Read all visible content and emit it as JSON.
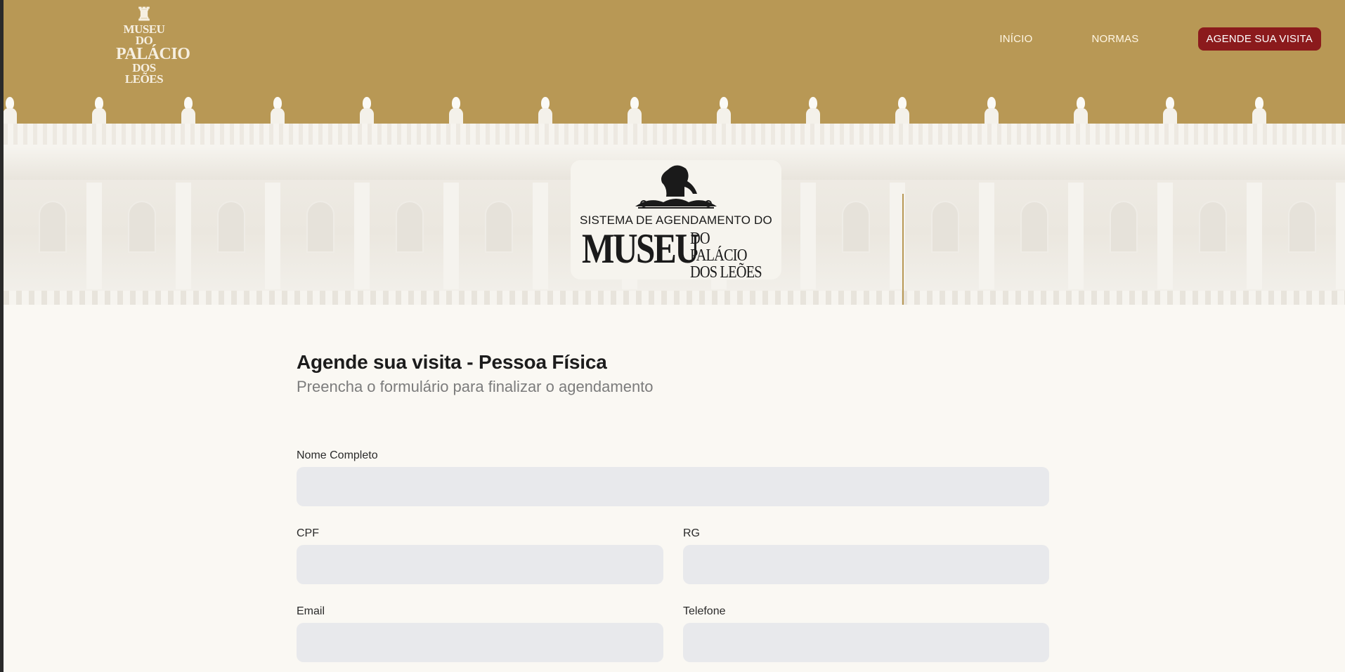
{
  "header": {
    "logo": {
      "line1": "MUSEU DO",
      "line2": "PALÁCIO",
      "line3": "DOS LEÕES"
    },
    "nav": [
      {
        "label": "INÍCIO"
      },
      {
        "label": "NORMAS"
      }
    ],
    "cta_label": "AGENDE SUA VISITA"
  },
  "hero": {
    "subtitle": "SISTEMA DE AGENDAMENTO DO",
    "museu": "MUSEU",
    "do_palacio": "DO PALÁCIO",
    "dos_leoes": "DOS LEÕES"
  },
  "form": {
    "title": "Agende sua visita - Pessoa Física",
    "subtitle": "Preencha o formulário para finalizar o agendamento",
    "fields": {
      "nome": {
        "label": "Nome Completo",
        "value": ""
      },
      "cpf": {
        "label": "CPF",
        "value": ""
      },
      "rg": {
        "label": "RG",
        "value": ""
      },
      "email": {
        "label": "Email",
        "value": ""
      },
      "telefone": {
        "label": "Telefone",
        "value": ""
      }
    }
  },
  "colors": {
    "header_bg": "#b89855",
    "cta_bg": "#8b1a1c",
    "page_bg": "#faf8f3",
    "input_bg": "#e8e9ec"
  }
}
